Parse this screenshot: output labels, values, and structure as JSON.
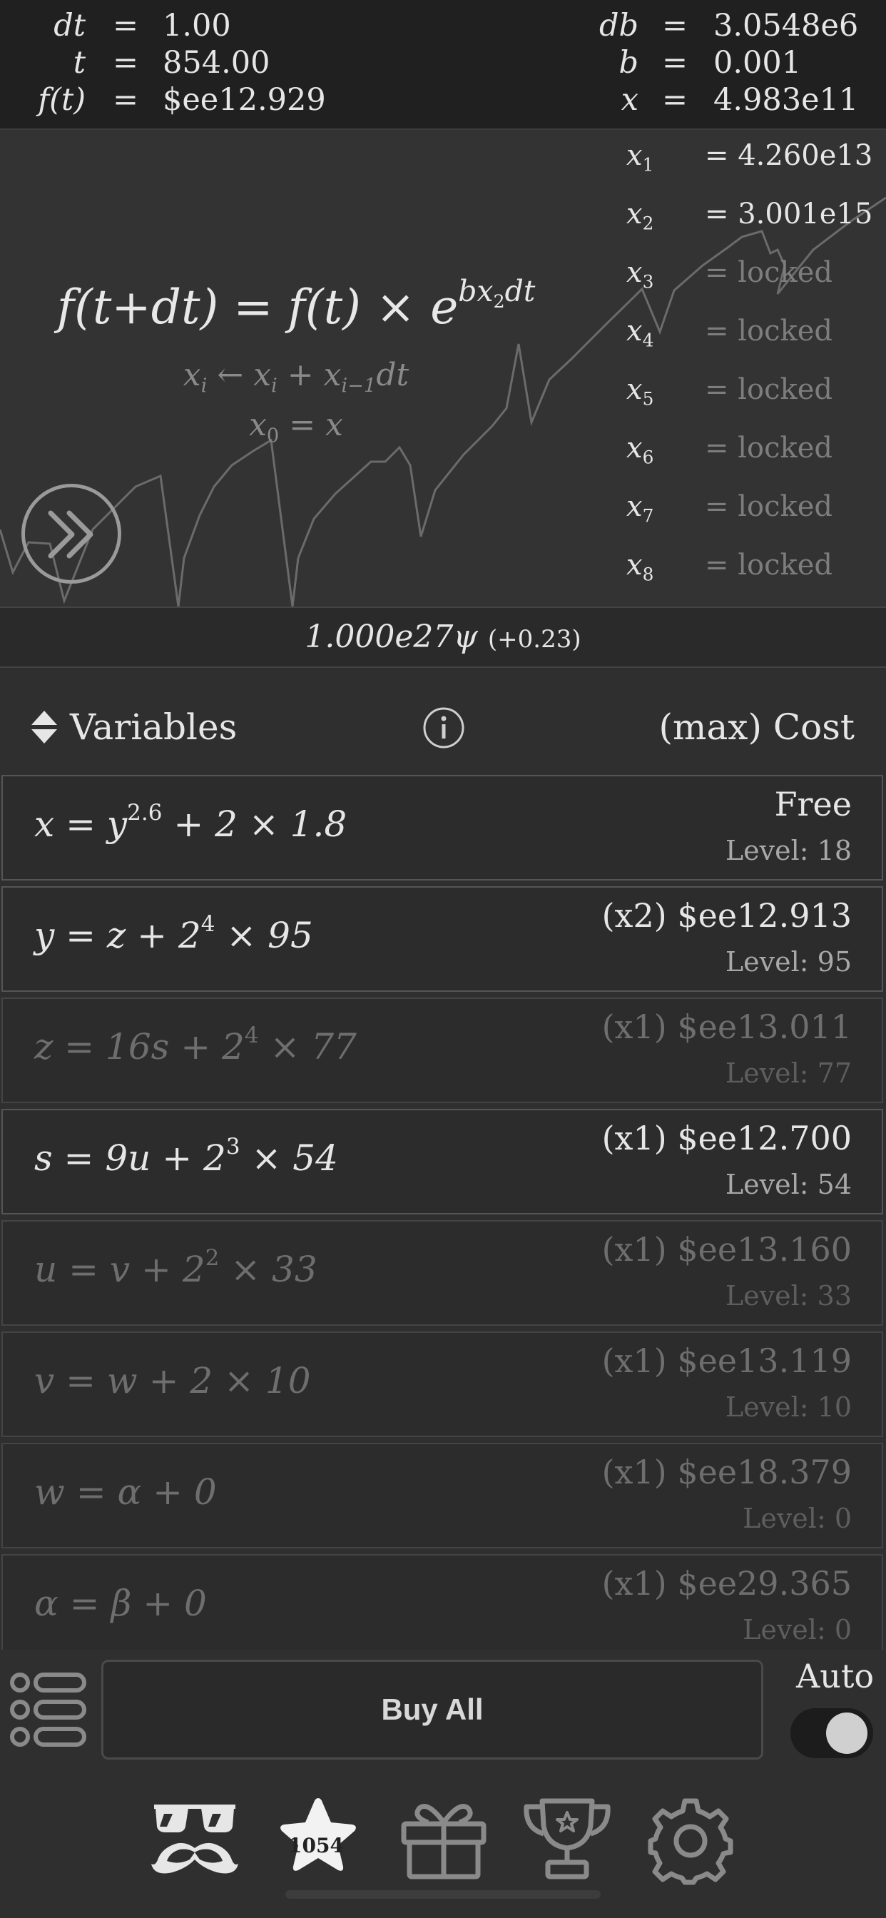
{
  "stats": {
    "dt": {
      "label": "dt",
      "value": "1.00"
    },
    "t": {
      "label": "t",
      "value": "854.00"
    },
    "ft": {
      "label": "f(t)",
      "value": "$ee12.929"
    },
    "db": {
      "label": "db",
      "value": "3.0548e6"
    },
    "b": {
      "label": "b",
      "value": "0.001"
    },
    "x": {
      "label": "x",
      "value": "4.983e11"
    },
    "eq": "="
  },
  "graph": {
    "formula_lhs": "f(t+dt) = f(t) × e",
    "formula_exp_base": "bx",
    "formula_exp_sub": "2",
    "formula_exp_tail": "dt",
    "rule1_a": "x",
    "rule1_a_sub": "i",
    "rule1_arrow": " ← x",
    "rule1_b_sub": "i",
    "rule1_c": " + x",
    "rule1_c_sub": "i−1",
    "rule1_d": "dt",
    "rule2_a": "x",
    "rule2_a_sub": "0",
    "rule2_b": " = x",
    "variables": [
      {
        "name": "x",
        "sub": "1",
        "value": "= 4.260e13",
        "locked": false
      },
      {
        "name": "x",
        "sub": "2",
        "value": "= 3.001e15",
        "locked": false
      },
      {
        "name": "x",
        "sub": "3",
        "value": "= locked",
        "locked": true
      },
      {
        "name": "x",
        "sub": "4",
        "value": "= locked",
        "locked": true
      },
      {
        "name": "x",
        "sub": "5",
        "value": "= locked",
        "locked": true
      },
      {
        "name": "x",
        "sub": "6",
        "value": "= locked",
        "locked": true
      },
      {
        "name": "x",
        "sub": "7",
        "value": "= locked",
        "locked": true
      },
      {
        "name": "x",
        "sub": "8",
        "value": "= locked",
        "locked": true
      }
    ]
  },
  "currency": {
    "value": "1.000e27ψ",
    "rate": "(+0.23)"
  },
  "upgrades_header": {
    "title": "Variables",
    "cost_title": "(max) Cost"
  },
  "upgrades": [
    {
      "lhs": "x = y",
      "exp": "2.6",
      "rhs": " + 2 × 1.8",
      "cost": "Free",
      "level": "Level: 18",
      "state": "avail"
    },
    {
      "lhs": "y = z + 2",
      "exp": "4",
      "rhs": " × 95",
      "cost": "(x2) $ee12.913",
      "level": "Level: 95",
      "state": "avail"
    },
    {
      "lhs": "z = 16s + 2",
      "exp": "4",
      "rhs": " × 77",
      "cost": "(x1) $ee13.011",
      "level": "Level: 77",
      "state": "dim"
    },
    {
      "lhs": "s = 9u + 2",
      "exp": "3",
      "rhs": " × 54",
      "cost": "(x1) $ee12.700",
      "level": "Level: 54",
      "state": "avail"
    },
    {
      "lhs": "u = v + 2",
      "exp": "2",
      "rhs": " × 33",
      "cost": "(x1) $ee13.160",
      "level": "Level: 33",
      "state": "dim"
    },
    {
      "lhs": "v = w + 2 × 10",
      "exp": "",
      "rhs": "",
      "cost": "(x1) $ee13.119",
      "level": "Level: 10",
      "state": "dim"
    },
    {
      "lhs": "w = α + 0",
      "exp": "",
      "rhs": "",
      "cost": "(x1) $ee18.379",
      "level": "Level: 0",
      "state": "dim"
    },
    {
      "lhs": "α = β + 0",
      "exp": "",
      "rhs": "",
      "cost": "(x1) $ee29.365",
      "level": "Level: 0",
      "state": "dim"
    }
  ],
  "bottom": {
    "buy_all": "Buy All",
    "auto_label": "Auto",
    "auto_on": true,
    "star_count": "1054",
    "nav_icons": [
      "glasses-mustache-icon",
      "star-icon",
      "gift-icon",
      "trophy-icon",
      "gear-icon"
    ]
  }
}
